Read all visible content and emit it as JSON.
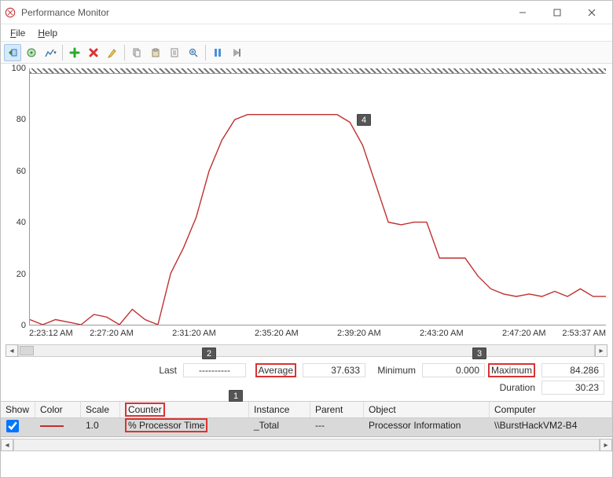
{
  "window": {
    "title": "Performance Monitor"
  },
  "menu": {
    "file": "File",
    "help": "Help"
  },
  "chart_data": {
    "type": "line",
    "ylim": [
      0,
      100
    ],
    "yticks": [
      0,
      20,
      40,
      60,
      80,
      100
    ],
    "xlabels": [
      "2:23:12 AM",
      "2:27:20 AM",
      "2:31:20 AM",
      "2:35:20 AM",
      "2:39:20 AM",
      "2:43:20 AM",
      "2:47:20 AM",
      "2:53:37 AM"
    ],
    "series": [
      {
        "name": "% Processor Time",
        "color": "#c03030",
        "values": [
          2,
          0,
          2,
          1,
          0,
          4,
          3,
          0,
          6,
          2,
          0,
          20,
          30,
          42,
          60,
          72,
          80,
          82,
          82,
          82,
          82,
          82,
          82,
          82,
          82,
          79,
          70,
          55,
          40,
          39,
          40,
          40,
          26,
          26,
          26,
          19,
          14,
          12,
          11,
          12,
          11,
          13,
          11,
          14,
          11,
          11
        ]
      }
    ]
  },
  "stats": {
    "last_label": "Last",
    "last_value": "----------",
    "average_label": "Average",
    "average_value": "37.633",
    "minimum_label": "Minimum",
    "minimum_value": "0.000",
    "maximum_label": "Maximum",
    "maximum_value": "84.286",
    "duration_label": "Duration",
    "duration_value": "30:23"
  },
  "grid": {
    "headers": {
      "show": "Show",
      "color": "Color",
      "scale": "Scale",
      "counter": "Counter",
      "instance": "Instance",
      "parent": "Parent",
      "object": "Object",
      "computer": "Computer"
    },
    "row": {
      "scale": "1.0",
      "counter": "% Processor Time",
      "instance": "_Total",
      "parent": "---",
      "object": "Processor Information",
      "computer": "\\\\BurstHackVM2-B4"
    }
  },
  "annotations": {
    "a1": "1",
    "a2": "2",
    "a3": "3",
    "a4": "4"
  }
}
